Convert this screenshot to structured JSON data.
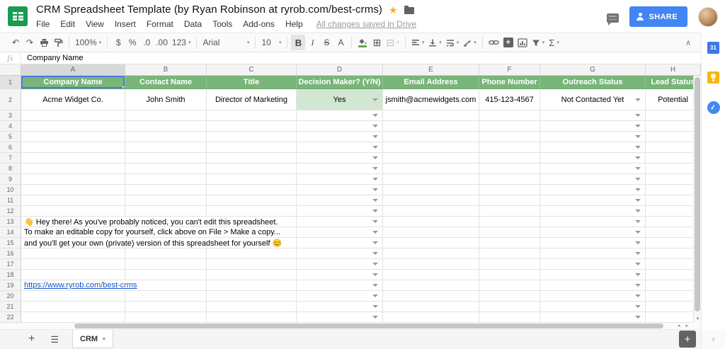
{
  "colors": {
    "header_green": "#79b579",
    "light_green": "#d2e7d2",
    "selection_blue": "#4a78e8",
    "share_blue": "#4285f4",
    "link_blue": "#1155cc",
    "star_gold": "#f7b500",
    "keep_yellow": "#f7b511",
    "calendar_blue": "#3b78e8"
  },
  "window": {
    "title": "CRM Spreadsheet Template (by Ryan Robinson at ryrob.com/best-crms)",
    "menu": [
      "File",
      "Edit",
      "View",
      "Insert",
      "Format",
      "Data",
      "Tools",
      "Add-ons",
      "Help"
    ],
    "saved_status": "All changes saved in Drive",
    "share_label": "SHARE"
  },
  "toolbar": {
    "zoom": "100%",
    "currency": "$",
    "percent": "%",
    "decrease_decimal": ".0",
    "increase_decimal": ".00",
    "more_formats": "123",
    "font": "Arial",
    "font_size": "10",
    "bold": "B",
    "italic": "I",
    "strikethrough": "S",
    "text_color": "A",
    "functions": "Σ"
  },
  "formula_bar": {
    "fx": "fx",
    "value": "Company Name"
  },
  "grid": {
    "columns": [
      "A",
      "B",
      "C",
      "D",
      "E",
      "F",
      "G",
      "H"
    ],
    "row_count": 22,
    "dropdown_columns": [
      "D",
      "G"
    ],
    "rows": [
      {
        "n": 1,
        "cells": {
          "A": {
            "text": "Company Name"
          },
          "B": {
            "text": "Contact Name"
          },
          "C": {
            "text": "Title"
          },
          "D": {
            "text": "Decision Maker? (Y/N)"
          },
          "E": {
            "text": "Email Address"
          },
          "F": {
            "text": "Phone Number"
          },
          "G": {
            "text": "Outreach Status"
          },
          "H": {
            "text": "Lead Status"
          }
        }
      },
      {
        "n": 2,
        "cells": {
          "A": {
            "text": "Acme Widget Co."
          },
          "B": {
            "text": "John Smith"
          },
          "C": {
            "text": "Director of Marketing"
          },
          "D": {
            "text": "Yes",
            "bg": "light_green"
          },
          "E": {
            "text": "jsmith@acmewidgets.com"
          },
          "F": {
            "text": "415-123-4567"
          },
          "G": {
            "text": "Not Contacted Yet"
          },
          "H": {
            "text": "Potential"
          }
        }
      },
      {
        "n": 13,
        "cells": {
          "A": {
            "text": "👋  Hey there! As you've probably noticed, you can't edit this spreadsheet.",
            "span": 3,
            "align": "left"
          }
        }
      },
      {
        "n": 14,
        "cells": {
          "A": {
            "text": "To make an editable copy for yourself, click above on File > Make a copy...",
            "span": 3,
            "align": "left"
          }
        }
      },
      {
        "n": 15,
        "cells": {
          "A": {
            "text": "and you'll get your own (private) version of this spreadsheet for yourself 😊",
            "span": 3,
            "align": "left"
          }
        }
      },
      {
        "n": 19,
        "cells": {
          "A": {
            "text": "https://www.ryrob.com/best-crms",
            "span": 2,
            "align": "left",
            "link": true
          }
        }
      }
    ]
  },
  "sheet_bar": {
    "active_tab": "CRM"
  },
  "side_panel": {
    "calendar_label": "31"
  }
}
